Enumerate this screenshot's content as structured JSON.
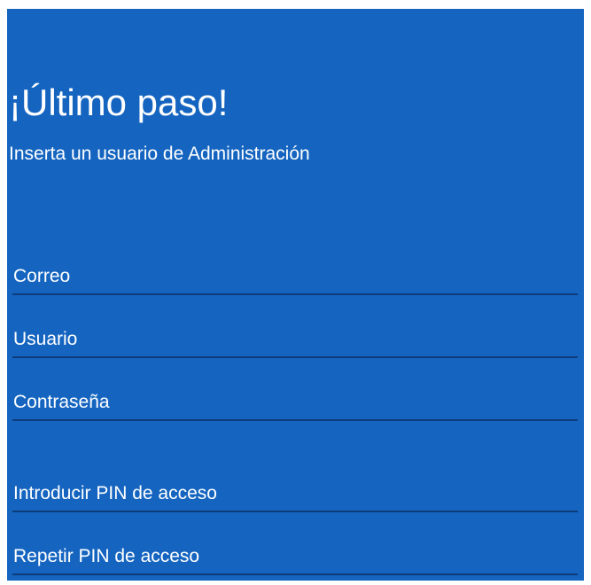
{
  "colors": {
    "background": "#1565c0",
    "text": "#ffffff",
    "underline": "#0d3c78"
  },
  "header": {
    "title": "¡Último paso!",
    "subtitle": "Inserta un usuario de Administración"
  },
  "form": {
    "fields": [
      {
        "placeholder": "Correo",
        "value": "",
        "type": "email"
      },
      {
        "placeholder": "Usuario",
        "value": "",
        "type": "text"
      },
      {
        "placeholder": "Contraseña",
        "value": "",
        "type": "password"
      },
      {
        "placeholder": "Introducir PIN de acceso",
        "value": "",
        "type": "password"
      },
      {
        "placeholder": "Repetir PIN de acceso",
        "value": "",
        "type": "password"
      }
    ]
  }
}
